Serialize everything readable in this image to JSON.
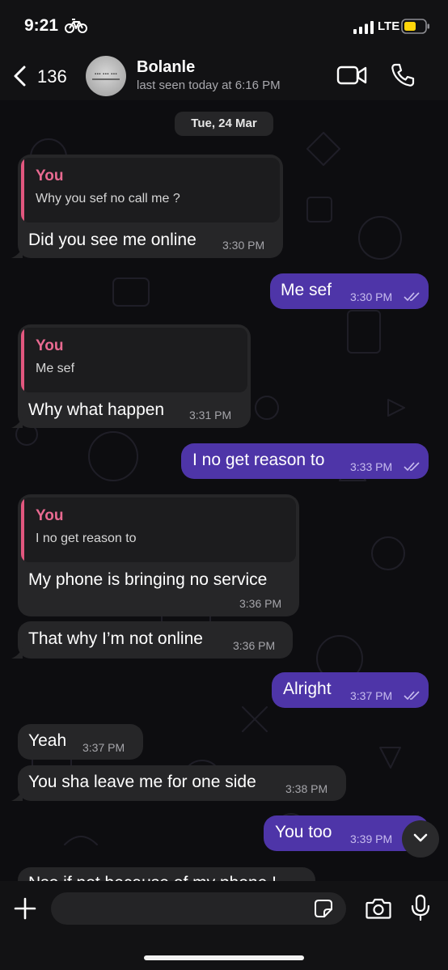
{
  "status_bar": {
    "time": "9:21",
    "network": "LTE",
    "colors": {
      "battery": "#ffd60a"
    }
  },
  "header": {
    "back_count": "136",
    "contact_name": "Bolanle",
    "last_seen": "last seen today at 6:16 PM"
  },
  "chat": {
    "date": "Tue, 24 Mar",
    "messages": [
      {
        "direction": "incoming",
        "reply_to": {
          "author": "You",
          "text": "Why you sef no call me ?"
        },
        "text": "Did you see me online",
        "time": "3:30 PM"
      },
      {
        "direction": "outgoing",
        "text": "Me sef",
        "time": "3:30 PM",
        "status": "read"
      },
      {
        "direction": "incoming",
        "reply_to": {
          "author": "You",
          "text": "Me sef"
        },
        "text": "Why what happen",
        "time": "3:31 PM"
      },
      {
        "direction": "outgoing",
        "text": "I no get reason to",
        "time": "3:33 PM",
        "status": "read"
      },
      {
        "direction": "incoming",
        "reply_to": {
          "author": "You",
          "text": "I no get reason to"
        },
        "text": "My phone is bringing no service",
        "time": "3:36 PM"
      },
      {
        "direction": "incoming",
        "text": "That why I’m not online",
        "time": "3:36 PM"
      },
      {
        "direction": "outgoing",
        "text": "Alright",
        "time": "3:37 PM",
        "status": "read"
      },
      {
        "direction": "incoming",
        "text": "Yeah",
        "time": "3:37 PM"
      },
      {
        "direction": "incoming",
        "text": "You sha leave me for one side",
        "time": "3:38 PM"
      },
      {
        "direction": "outgoing",
        "text": "You too",
        "time": "3:39 PM",
        "status": "read"
      },
      {
        "direction": "incoming",
        "text": "Nso if not because of my phone !",
        "time": ""
      }
    ]
  },
  "input": {
    "placeholder": ""
  },
  "colors": {
    "outgoing_bubble": "#4e35a8",
    "incoming_bubble": "#262628",
    "reply_accent": "#e2577f",
    "background": "#0d0d10"
  },
  "icons": [
    "bike-icon",
    "signal-icon",
    "battery-icon",
    "back-icon",
    "video-call-icon",
    "phone-call-icon",
    "chevron-down-icon",
    "plus-icon",
    "sticker-icon",
    "camera-icon",
    "microphone-icon",
    "read-ticks-icon"
  ]
}
